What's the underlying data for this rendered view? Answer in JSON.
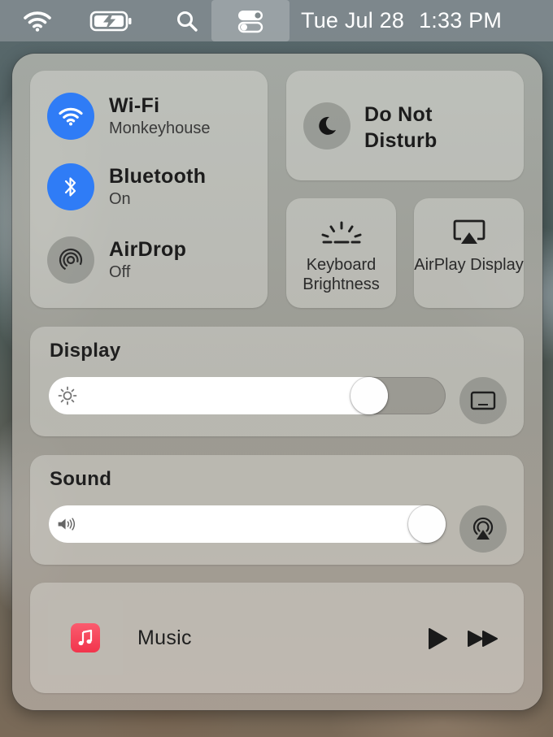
{
  "menubar": {
    "icons": [
      "wifi-icon",
      "battery-charging-icon",
      "search-icon",
      "control-center-icon"
    ],
    "day_date": "Tue Jul 28",
    "time": "1:33 PM"
  },
  "network": {
    "wifi": {
      "title": "Wi-Fi",
      "status": "Monkeyhouse",
      "icon": "wifi-icon",
      "active": true
    },
    "bluetooth": {
      "title": "Bluetooth",
      "status": "On",
      "icon": "bluetooth-icon",
      "active": true
    },
    "airdrop": {
      "title": "AirDrop",
      "status": "Off",
      "icon": "airdrop-icon",
      "active": false
    }
  },
  "dnd": {
    "label": "Do Not Disturb",
    "icon": "moon-icon"
  },
  "keyboard_brightness": {
    "label": "Keyboard Brightness",
    "icon": "keyboard-brightness-icon"
  },
  "airplay_display": {
    "label": "AirPlay Display",
    "icon": "airplay-display-icon"
  },
  "display": {
    "title": "Display",
    "brightness_level": 0.84,
    "icon": "sun-icon",
    "side_icon": "display-icon"
  },
  "sound": {
    "title": "Sound",
    "volume_level": 1.0,
    "icon": "speaker-icon",
    "side_icon": "airplay-audio-icon"
  },
  "now_playing": {
    "app": "Music",
    "icon": "music-app-icon",
    "controls": [
      "play-icon",
      "fast-forward-icon"
    ]
  },
  "colors": {
    "accent": "#2f7cf6",
    "music_red": "#f2344c"
  }
}
